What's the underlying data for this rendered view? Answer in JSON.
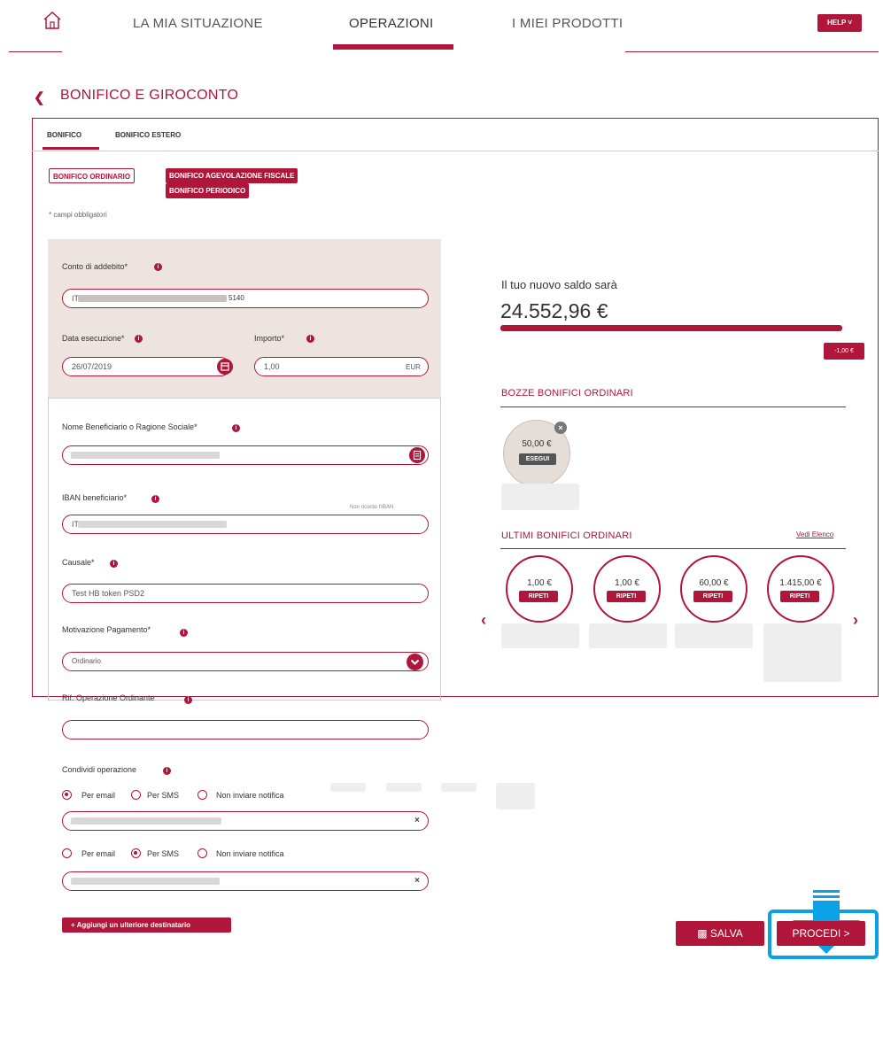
{
  "nav": {
    "items": [
      "LA MIA SITUAZIONE",
      "OPERAZIONI",
      "I MIEI PRODOTTI"
    ],
    "help_label": "HELP ˅"
  },
  "page": {
    "title": "BONIFICO E GIROCONTO"
  },
  "tabs": [
    "BONIFICO",
    "BONIFICO ESTERO"
  ],
  "type_buttons": [
    "BONIFICO ORDINARIO",
    "BONIFICO AGEVOLAZIONE FISCALE",
    "BONIFICO PERIODICO"
  ],
  "required_note": "* campi obbligatori",
  "form": {
    "conto_label": "Conto di addebito*",
    "conto_value_tail": "5140",
    "conto_value_head": "IT",
    "data_label": "Data esecuzione*",
    "data_value": "26/07/2019",
    "importo_label": "Importo*",
    "importo_value": "1,00",
    "importo_currency": "EUR",
    "beneficiario_label": "Nome Beneficiario o Ragione Sociale*",
    "iban_label": "IBAN beneficiario*",
    "iban_hint": "Non ricordo l'IBAN",
    "iban_value_head": "IT",
    "causale_label": "Causale*",
    "causale_value": "Test HB token PSD2",
    "motivazione_label": "Motivazione Pagamento*",
    "motivazione_value": "Ordinario",
    "rif_label": "Rif. Operazione Ordinante",
    "condividi_label": "Condividi operazione",
    "opt_email": "Per email",
    "opt_sms": "Per SMS",
    "opt_none": "Non inviare notifica",
    "add_recipient": "+ Aggiungi un ulteriore destinatario"
  },
  "saldo": {
    "label": "Il tuo nuovo saldo sarà",
    "value": "24.552,96 €",
    "delta": "-1,00 €",
    "fill_fraction": 0.99
  },
  "bozze": {
    "title": "BOZZE BONIFICI ORDINARI",
    "item_amount": "50,00 €",
    "item_action": "ESEGUI"
  },
  "ultimi": {
    "title": "ULTIMI BONIFICI ORDINARI",
    "link": "Vedi Elenco",
    "items": [
      {
        "amount": "1,00 €",
        "action": "RIPETI"
      },
      {
        "amount": "1,00 €",
        "action": "RIPETI"
      },
      {
        "amount": "60,00 €",
        "action": "RIPETI"
      },
      {
        "amount": "1.415,00 €",
        "action": "RIPETI"
      }
    ]
  },
  "actions": {
    "salva": "SALVA",
    "procedi": "PROCEDI >"
  },
  "colors": {
    "accent": "#b0163a",
    "highlight": "#0aa2e4",
    "panel_bg": "#ede4df"
  },
  "icons": [
    "home-icon",
    "back-chevron-icon",
    "info-icon",
    "calendar-icon",
    "address-book-icon",
    "dropdown-chevron-icon",
    "close-icon",
    "save-icon",
    "arrow-down-icon"
  ]
}
